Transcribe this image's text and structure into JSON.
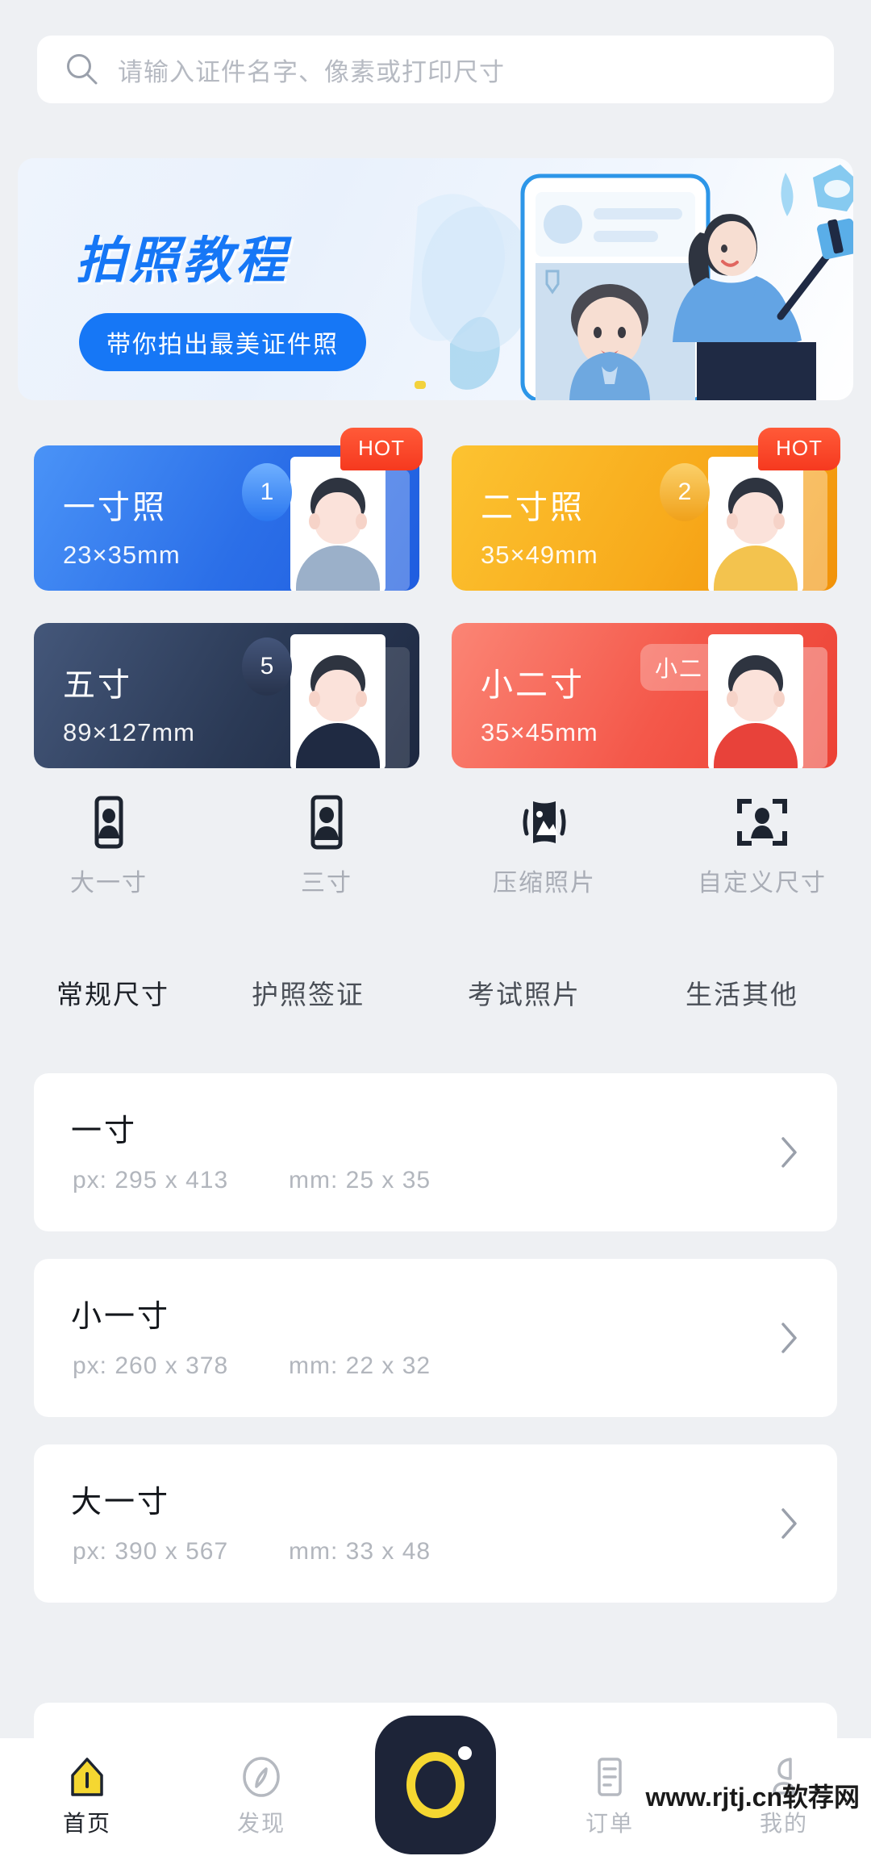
{
  "search": {
    "placeholder": "请输入证件名字、像素或打印尺寸",
    "icon": "search-icon"
  },
  "banner": {
    "title": "拍照教程",
    "button_label": "带你拍出最美证件照",
    "accent_color": "#1677f6"
  },
  "size_cards": [
    {
      "title": "一寸照",
      "dimensions": "23×35mm",
      "badge": "HOT",
      "number": "1",
      "color_start": "#3d8cf5",
      "color_end": "#1f5fe0"
    },
    {
      "title": "二寸照",
      "dimensions": "35×49mm",
      "badge": "HOT",
      "number": "2",
      "color_start": "#fcc02e",
      "color_end": "#f0960f"
    },
    {
      "title": "五寸",
      "dimensions": "89×127mm",
      "badge": "",
      "number": "5",
      "color_start": "#3b4c6b",
      "color_end": "#1e2a42"
    },
    {
      "title": "小二寸",
      "dimensions": "35×45mm",
      "badge": "",
      "number": "小二",
      "color_start": "#fa7a6b",
      "color_end": "#ef4335"
    }
  ],
  "quick_icons": [
    {
      "label": "大一寸",
      "icon": "portrait-frame-icon"
    },
    {
      "label": "三寸",
      "icon": "portrait-frame-icon"
    },
    {
      "label": "压缩照片",
      "icon": "compress-image-icon"
    },
    {
      "label": "自定义尺寸",
      "icon": "crop-face-icon"
    }
  ],
  "tabs": {
    "active_index": 0,
    "highlight_color": "#f5d731",
    "items": [
      {
        "label": "常规尺寸"
      },
      {
        "label": "护照签证"
      },
      {
        "label": "考试照片"
      },
      {
        "label": "生活其他"
      }
    ]
  },
  "size_list": [
    {
      "name": "一寸",
      "px": "px: 295 x 413",
      "mm": "mm: 25 x 35"
    },
    {
      "name": "小一寸",
      "px": "px: 260 x 378",
      "mm": "mm: 22 x 32"
    },
    {
      "name": "大一寸",
      "px": "px: 390 x 567",
      "mm": "mm: 33 x 48"
    }
  ],
  "bottom_nav": {
    "active_index": 0,
    "items": [
      {
        "label": "首页",
        "icon": "home-icon"
      },
      {
        "label": "发现",
        "icon": "compass-icon"
      },
      {
        "label": "订单",
        "icon": "order-list-icon"
      },
      {
        "label": "我的",
        "icon": "profile-icon"
      }
    ],
    "center_button_icon": "camera-shutter-icon"
  },
  "watermark": {
    "text": "www.rjtj.cn软荐网"
  }
}
